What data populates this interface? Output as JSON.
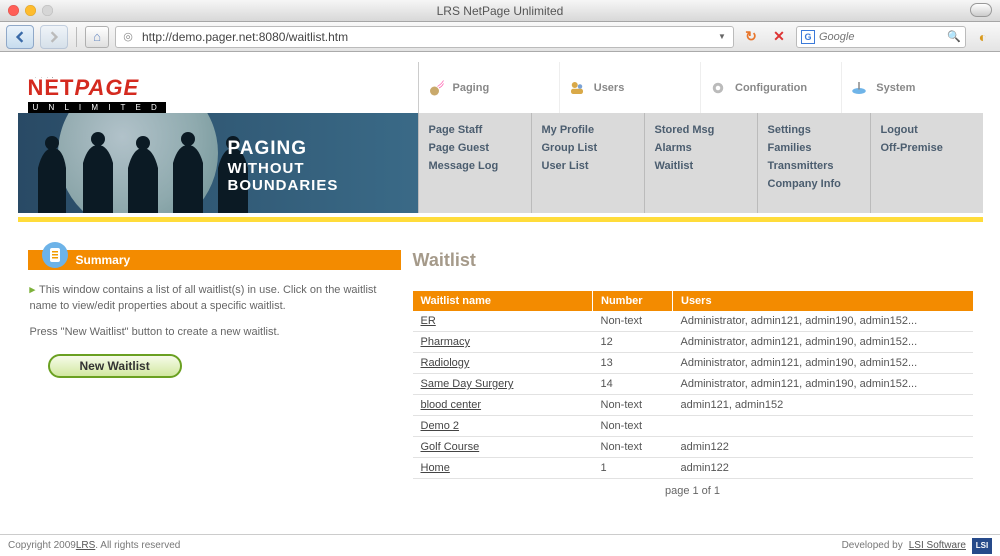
{
  "window": {
    "title": "LRS NetPage Unlimited"
  },
  "browser": {
    "url": "http://demo.pager.net:8080/waitlist.htm",
    "search_placeholder": "Google"
  },
  "logo": {
    "top": "NETPAGE",
    "sub": "U N L I M I T E D"
  },
  "topnav": [
    {
      "label": "Paging"
    },
    {
      "label": "Users"
    },
    {
      "label": "Configuration"
    },
    {
      "label": "System"
    }
  ],
  "slogan": {
    "l1": "PAGING",
    "l2": "WITHOUT BOUNDARIES"
  },
  "subnav": {
    "col0": [
      "Page Staff",
      "Page Guest",
      "Message Log"
    ],
    "col1": [
      "My Profile",
      "Group List",
      "User List"
    ],
    "col2": [
      "Stored Msg",
      "Alarms",
      "Waitlist"
    ],
    "col3": [
      "Settings",
      "Families",
      "Transmitters",
      "Company Info"
    ],
    "col4": [
      "Logout",
      "Off-Premise"
    ]
  },
  "summary": {
    "heading": "Summary",
    "p1": "This window contains a list of all waitlist(s) in use. Click on the waitlist name to view/edit properties about a specific waitlist.",
    "p2": "Press \"New Waitlist\" button to create a new waitlist.",
    "button": "New Waitlist"
  },
  "content": {
    "title": "Waitlist",
    "columns": {
      "name": "Waitlist name",
      "number": "Number",
      "users": "Users"
    },
    "rows": [
      {
        "name": "ER",
        "number": "Non-text",
        "users": "Administrator, admin121, admin190, admin152..."
      },
      {
        "name": "Pharmacy",
        "number": "12",
        "users": "Administrator, admin121, admin190, admin152..."
      },
      {
        "name": "Radiology",
        "number": "13",
        "users": "Administrator, admin121, admin190, admin152..."
      },
      {
        "name": "Same Day Surgery",
        "number": "14",
        "users": "Administrator, admin121, admin190, admin152..."
      },
      {
        "name": "blood center",
        "number": "Non-text",
        "users": "admin121, admin152"
      },
      {
        "name": "Demo 2",
        "number": "Non-text",
        "users": ""
      },
      {
        "name": "Golf Course",
        "number": "Non-text",
        "users": "admin122"
      },
      {
        "name": "Home",
        "number": "1",
        "users": "admin122"
      }
    ],
    "pager": "page 1 of 1"
  },
  "footer": {
    "copyright_pre": "Copyright 2009 ",
    "copyright_link": "LRS",
    "copyright_post": ". All rights reserved",
    "dev_pre": "Developed by ",
    "dev_link": "LSI Software"
  }
}
